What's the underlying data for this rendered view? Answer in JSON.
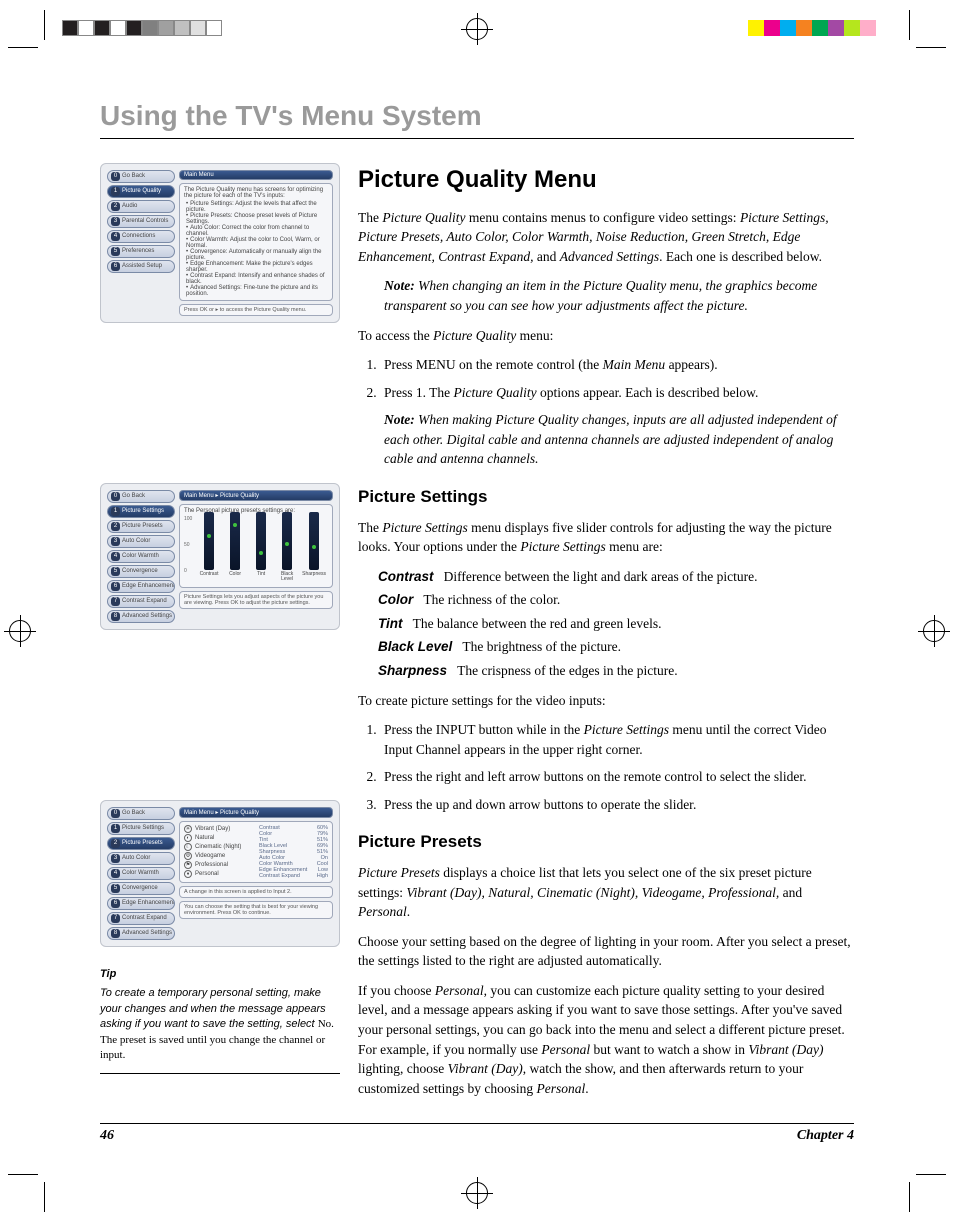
{
  "colorbar_left": [
    "#231f20",
    "#ffffff",
    "#231f20",
    "#ffffff",
    "#231f20",
    "#808080",
    "#a0a0a0",
    "#c0c0c0",
    "#e0e0e0",
    "#ffffff"
  ],
  "colorbar_right": [
    "#fff200",
    "#ec008c",
    "#00aeef",
    "#f58220",
    "#00a651",
    "#a349a4",
    "#b5e61d",
    "#ffaec9",
    "#ffffff"
  ],
  "chapter_title": "Using the TV's Menu System",
  "footer": {
    "page": "46",
    "chapter": "Chapter 4"
  },
  "h1": "Picture Quality Menu",
  "intro": {
    "pre": "The ",
    "menu": "Picture Quality",
    "mid": " menu contains menus to configure video settings: ",
    "list": "Picture Settings, Picture Presets, Auto Color, Color Warmth, Noise Reduction, Green Stretch, Edge Enhancement, Contrast Expand,",
    "and": " and ",
    "last": "Advanced Settings",
    "post": ". Each one is described below."
  },
  "note1": {
    "head": "Note:",
    "body": " When changing an item in the Picture Quality menu, the graphics become transparent so you can see how your adjustments affect the picture."
  },
  "access": {
    "lead": "To access the ",
    "menu": "Picture Quality",
    "post": " menu:",
    "step1_pre": "Press MENU on the remote control (the ",
    "step1_mm": "Main Menu",
    "step1_post": " appears).",
    "step2_pre": "Press 1. The ",
    "step2_mm": "Picture Quality",
    "step2_post": " options appear. Each is described below."
  },
  "note2": {
    "head": "Note:",
    "body": " When making Picture Quality changes, inputs are all adjusted independent of each other. Digital cable and antenna channels are adjusted independent of analog cable and antenna channels."
  },
  "ps": {
    "h": "Picture Settings",
    "p1_pre": "The ",
    "p1_menu": "Picture Settings",
    "p1_mid": " menu displays five slider controls for adjusting the way the picture looks. Your options under the ",
    "p1_menu2": "Picture Settings",
    "p1_post": " menu are:",
    "defs": [
      {
        "term": "Contrast",
        "desc": "Difference between the light and dark areas of the picture."
      },
      {
        "term": "Color",
        "desc": "The richness of the color."
      },
      {
        "term": "Tint",
        "desc": "The balance between the red and green levels."
      },
      {
        "term": "Black Level",
        "desc": "The brightness of the picture."
      },
      {
        "term": "Sharpness",
        "desc": "The crispness of the edges in the picture."
      }
    ],
    "lead2": "To create picture settings for the video inputs:",
    "steps": [
      {
        "pre": "Press the INPUT button while in the ",
        "em": "Picture Settings",
        "post": " menu until the correct Video Input Channel appears in the upper right corner."
      },
      {
        "pre": "Press the right and left arrow buttons on the remote control to select the slider.",
        "em": "",
        "post": ""
      },
      {
        "pre": "Press the up and down arrow buttons to operate the slider.",
        "em": "",
        "post": ""
      }
    ]
  },
  "pp": {
    "h": "Picture Presets",
    "p1_pre": "",
    "p1_em": "Picture Presets",
    "p1_mid": " displays a choice list that lets you select one of the six preset picture settings: ",
    "p1_list": "Vibrant (Day), Natural, Cinematic (Night), Videogame, Professional,",
    "p1_and": " and ",
    "p1_last": "Personal",
    "p1_post": ".",
    "p2": "Choose your setting based on the degree of lighting in your room. After you select a preset, the settings listed to the right are adjusted automatically.",
    "p3_a": "If you choose ",
    "p3_personal": "Personal",
    "p3_b": ", you can customize each picture quality setting to your desired level, and a message appears asking if you want to save those settings. After you've saved your personal settings, you can go back into the menu and select a different picture preset. For example, if you normally use ",
    "p3_c": " but want to watch a show in ",
    "p3_vib": "Vibrant (Day)",
    "p3_d": " lighting, choose ",
    "p3_e": ", watch the show, and then afterwards return to your customized settings by choosing ",
    "p3_f": "."
  },
  "tip": {
    "head": "Tip",
    "body_a": "To create a temporary personal setting, make your changes and when the message appears asking if you want to save the setting, select ",
    "no": "No",
    "body_b": ". The preset is saved until you change the channel or input."
  },
  "shot1": {
    "crumb": "Main Menu",
    "nav": [
      {
        "n": "0",
        "label": "Go Back"
      },
      {
        "n": "1",
        "label": "Picture Quality",
        "sel": true
      },
      {
        "n": "2",
        "label": "Audio"
      },
      {
        "n": "3",
        "label": "Parental Controls"
      },
      {
        "n": "4",
        "label": "Connections"
      },
      {
        "n": "5",
        "label": "Preferences"
      },
      {
        "n": "6",
        "label": "Assisted Setup"
      }
    ],
    "desc_head": "The Picture Quality menu has screens for optimizing the picture for each of the TV's inputs:",
    "bullets": [
      "Picture Settings: Adjust the levels that affect the picture.",
      "Picture Presets: Choose preset levels of Picture Settings.",
      "Auto Color: Correct the color from channel to channel.",
      "Color Warmth: Adjust the color to Cool, Warm, or Normal.",
      "Convergence: Automatically or manually align the picture.",
      "Edge Enhancement: Make the picture's edges sharper.",
      "Contrast Expand: Intensify and enhance shades of black.",
      "Advanced Settings: Fine-tune the picture and its position."
    ],
    "hint": "Press OK or ▸ to access the Picture Quality menu."
  },
  "shot2": {
    "crumb": "Main Menu ▸ Picture Quality",
    "nav": [
      {
        "n": "0",
        "label": "Go Back"
      },
      {
        "n": "1",
        "label": "Picture Settings",
        "sel": true
      },
      {
        "n": "2",
        "label": "Picture Presets"
      },
      {
        "n": "3",
        "label": "Auto Color"
      },
      {
        "n": "4",
        "label": "Color Warmth"
      },
      {
        "n": "5",
        "label": "Convergence"
      },
      {
        "n": "6",
        "label": "Edge Enhancement"
      },
      {
        "n": "7",
        "label": "Contrast Expand"
      },
      {
        "n": "8",
        "label": "Advanced Settings"
      }
    ],
    "desc_head": "The Personal picture presets settings are:",
    "ylabels": {
      "top": "100",
      "mid": "50",
      "bot": "0"
    },
    "sliders": [
      {
        "label": "Contrast",
        "val": 60
      },
      {
        "label": "Color",
        "val": 79
      },
      {
        "label": "Tint",
        "val": 28
      },
      {
        "label": "Black Level",
        "val": 45
      },
      {
        "label": "Sharpness",
        "val": 38
      }
    ],
    "hint": "Picture Settings lets you adjust aspects of the picture you are viewing. Press OK to adjust the picture settings."
  },
  "shot3": {
    "crumb": "Main Menu ▸ Picture Quality",
    "nav": [
      {
        "n": "0",
        "label": "Go Back"
      },
      {
        "n": "1",
        "label": "Picture Settings"
      },
      {
        "n": "2",
        "label": "Picture Presets",
        "sel": true
      },
      {
        "n": "3",
        "label": "Auto Color"
      },
      {
        "n": "4",
        "label": "Color Warmth"
      },
      {
        "n": "5",
        "label": "Convergence"
      },
      {
        "n": "6",
        "label": "Edge Enhancement"
      },
      {
        "n": "7",
        "label": "Contrast Expand"
      },
      {
        "n": "8",
        "label": "Advanced Settings"
      }
    ],
    "presets": [
      "Vibrant (Day)",
      "Natural",
      "Cinematic (Night)",
      "Videogame",
      "Professional",
      "Personal"
    ],
    "stats": [
      {
        "k": "Contrast",
        "v": "60%"
      },
      {
        "k": "Color",
        "v": "79%"
      },
      {
        "k": "Tint",
        "v": "51%"
      },
      {
        "k": "Black Level",
        "v": "69%"
      },
      {
        "k": "Sharpness",
        "v": "51%"
      },
      {
        "k": "Auto Color",
        "v": "On"
      },
      {
        "k": "Color Warmth",
        "v": "Cool"
      },
      {
        "k": "Edge Enhancement",
        "v": "Low"
      },
      {
        "k": "Contrast Expand",
        "v": "High"
      }
    ],
    "hint1": "A change in this screen is applied to Input 2.",
    "hint2": "You can choose the setting that is best for your viewing environment. Press OK to continue."
  }
}
